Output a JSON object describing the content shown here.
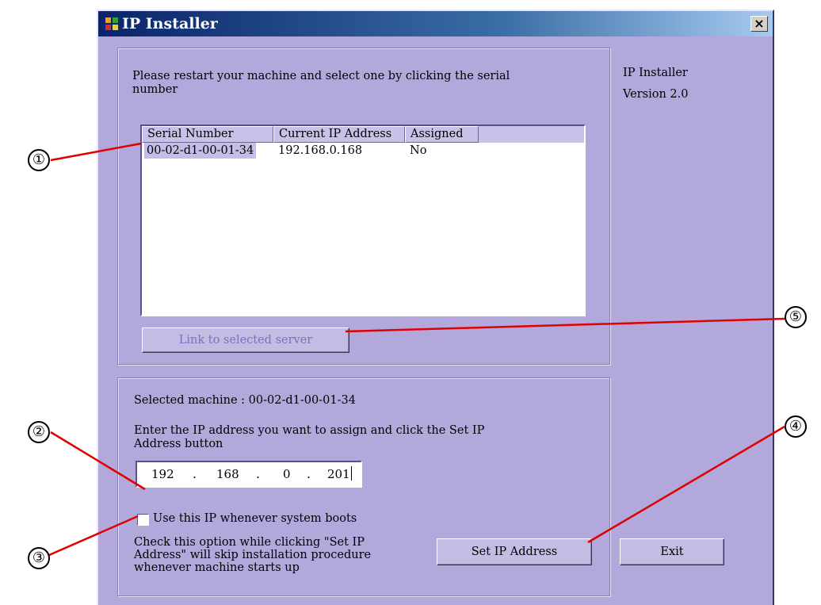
{
  "window": {
    "title": "IP Installer",
    "close_label": "×"
  },
  "group1": {
    "prompt": "Please restart your machine and select one by clicking the serial number",
    "columns": [
      "Serial Number",
      "Current IP Address",
      "Assigned"
    ],
    "rows": [
      {
        "serial": "00-02-d1-00-01-34",
        "ip": "192.168.0.168",
        "assigned": "No"
      }
    ],
    "link_button": "Link to selected server"
  },
  "sidebar": {
    "app_name": "IP Installer",
    "version": "Version 2.0"
  },
  "group2": {
    "selected_label": "Selected machine : 00-02-d1-00-01-34",
    "enter_text": "Enter the IP address you want to assign and click the Set IP Address button",
    "ip": [
      "192",
      "168",
      "0",
      "201"
    ],
    "ip_dot": ".",
    "checkbox_label": "Use this IP whenever system boots",
    "checkbox_checked": false,
    "note": "Check this option while clicking \"Set IP Address\" will skip installation procedure whenever machine starts up",
    "set_button": "Set IP Address"
  },
  "exit_button": "Exit",
  "callouts": [
    "①",
    "②",
    "③",
    "④",
    "⑤"
  ],
  "colors": {
    "window_bg": "#b3a8dc",
    "title_bar": "#0a246a",
    "callout_line": "#e00000"
  }
}
